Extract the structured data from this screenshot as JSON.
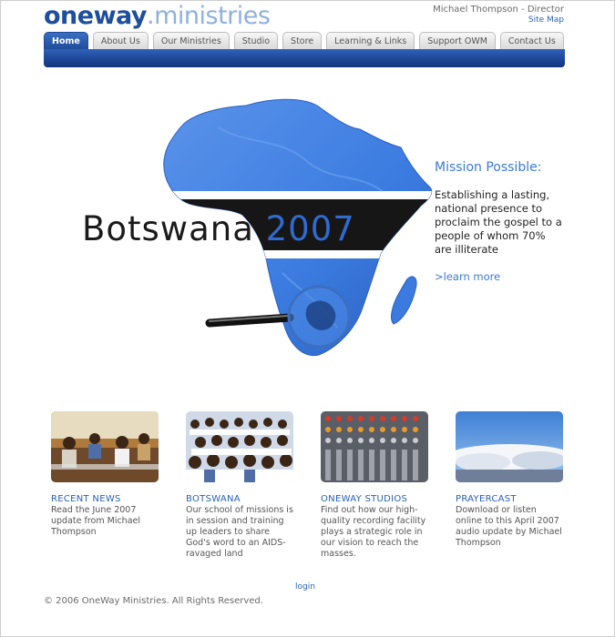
{
  "header": {
    "logo_part1": "oneway",
    "logo_part2": ".ministries",
    "director": "Michael Thompson - Director",
    "site_map": "Site Map"
  },
  "nav": {
    "tabs": [
      {
        "label": "Home",
        "active": true
      },
      {
        "label": "About Us",
        "active": false
      },
      {
        "label": "Our Ministries",
        "active": false
      },
      {
        "label": "Studio",
        "active": false
      },
      {
        "label": "Store",
        "active": false
      },
      {
        "label": "Learning & Links",
        "active": false
      },
      {
        "label": "Support OWM",
        "active": false
      },
      {
        "label": "Contact Us",
        "active": false
      }
    ]
  },
  "hero": {
    "word": "Botswana",
    "year": "2007",
    "mission_title": "Mission Possible:",
    "mission_text": "Establishing a lasting, national presence to proclaim the gospel to a people of whom 70% are illiterate",
    "learn_more": ">learn more"
  },
  "features": [
    {
      "title": "RECENT NEWS",
      "text": "Read the June 2007 update from Michael Thompson"
    },
    {
      "title": "BOTSWANA",
      "text": "Our school of missions is in session and training up leaders to share God's word to an AIDS-ravaged land"
    },
    {
      "title": "ONEWAY STUDIOS",
      "text": "Find out how our high-quality recording facility plays a strategic role in our vision to reach the masses."
    },
    {
      "title": "PRAYERCAST",
      "text": "Download or listen online to this April 2007 audio update by Michael Thompson"
    }
  ],
  "footer": {
    "login": "login",
    "copyright": "© 2006 OneWay Ministries. All Rights Reserved."
  },
  "colors": {
    "brand_blue": "#1f4e9c",
    "accent_blue": "#3a7ad6",
    "map_blue": "#3b7be0"
  }
}
